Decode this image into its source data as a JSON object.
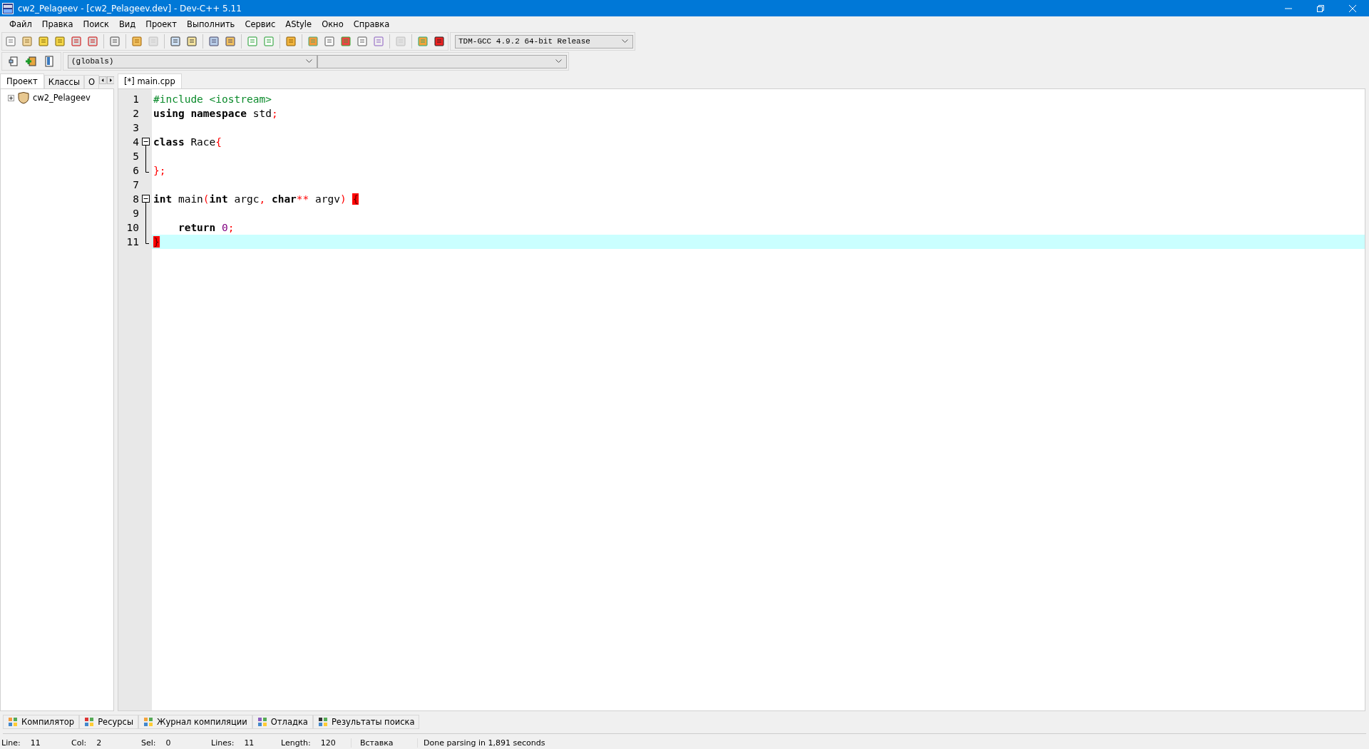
{
  "window": {
    "title": "cw2_Pelageev - [cw2_Pelageev.dev] - Dev-C++ 5.11"
  },
  "menu": [
    {
      "label": "Файл"
    },
    {
      "label": "Правка"
    },
    {
      "label": "Поиск"
    },
    {
      "label": "Вид"
    },
    {
      "label": "Проект"
    },
    {
      "label": "Выполнить"
    },
    {
      "label": "Сервис"
    },
    {
      "label": "AStyle"
    },
    {
      "label": "Окно"
    },
    {
      "label": "Справка"
    }
  ],
  "toolbar": [
    {
      "disabled": false
    },
    {
      "disabled": false
    },
    {
      "disabled": false
    },
    {
      "disabled": false
    },
    {
      "disabled": false
    },
    {
      "disabled": false
    },
    {
      "disabled": false
    },
    {
      "disabled": false
    },
    {
      "disabled": true
    },
    {
      "disabled": false
    },
    {
      "disabled": false
    },
    {
      "disabled": false
    },
    {
      "disabled": false
    },
    {
      "disabled": false
    },
    {
      "disabled": false
    },
    {
      "disabled": false
    },
    {
      "disabled": false
    },
    {
      "disabled": false
    },
    {
      "disabled": false
    },
    {
      "disabled": false
    },
    {
      "disabled": false
    },
    {
      "disabled": true
    },
    {
      "disabled": false
    },
    {
      "disabled": false
    }
  ],
  "compiler_select": {
    "value": "TDM-GCC 4.9.2 64-bit Release"
  },
  "scope_select": {
    "value": "(globals)"
  },
  "left_tabs": [
    {
      "label": "Проект",
      "selected": true
    },
    {
      "label": "Классы",
      "selected": false
    },
    {
      "label": "О",
      "selected": false
    }
  ],
  "project_tree": [
    {
      "label": "cw2_Pelageev",
      "expanded": false
    }
  ],
  "editor_tabs": [
    {
      "label": "[*] main.cpp",
      "selected": true
    }
  ],
  "code_lines": [
    {
      "number": "1",
      "kind": "plain",
      "current": false,
      "tokens": [
        {
          "kind": "preproc",
          "text": "#include <iostream>"
        }
      ]
    },
    {
      "number": "2",
      "kind": "plain",
      "current": false,
      "tokens": [
        {
          "kind": "keyword",
          "text": "using namespace"
        },
        {
          "kind": "plain",
          "text": " std"
        },
        {
          "kind": "punct",
          "text": ";"
        }
      ]
    },
    {
      "number": "3",
      "kind": "plain",
      "current": false
    },
    {
      "number": "4",
      "kind": "fold_start",
      "current": false,
      "tokens": [
        {
          "kind": "keyword",
          "text": "class"
        },
        {
          "kind": "plain",
          "text": " Race"
        },
        {
          "kind": "punct",
          "text": "{"
        }
      ]
    },
    {
      "number": "5",
      "kind": "fold_body",
      "current": false
    },
    {
      "number": "6",
      "kind": "fold_end",
      "current": false,
      "tokens": [
        {
          "kind": "punct",
          "text": "};"
        }
      ]
    },
    {
      "number": "7",
      "kind": "plain",
      "current": false
    },
    {
      "number": "8",
      "kind": "fold_start",
      "current": false,
      "tokens": [
        {
          "kind": "keyword",
          "text": "int"
        },
        {
          "kind": "plain",
          "text": " main"
        },
        {
          "kind": "punct",
          "text": "("
        },
        {
          "kind": "keyword",
          "text": "int"
        },
        {
          "kind": "plain",
          "text": " argc"
        },
        {
          "kind": "punct",
          "text": ","
        },
        {
          "kind": "keyword",
          "text": " char"
        },
        {
          "kind": "punct",
          "text": "**"
        },
        {
          "kind": "plain",
          "text": " argv"
        },
        {
          "kind": "punct",
          "text": ") "
        },
        {
          "kind": "brace_match",
          "text": "{"
        }
      ]
    },
    {
      "number": "9",
      "kind": "fold_body",
      "current": false
    },
    {
      "number": "10",
      "kind": "fold_body",
      "current": false,
      "tokens": [
        {
          "kind": "keyword",
          "text": "    return"
        },
        {
          "kind": "number",
          "text": " 0"
        },
        {
          "kind": "punct",
          "text": ";"
        }
      ]
    },
    {
      "number": "11",
      "kind": "fold_end",
      "current": true,
      "tokens": [
        {
          "kind": "brace_match",
          "text": "}"
        }
      ]
    }
  ],
  "bottom_tabs": [
    {
      "label": "Компилятор"
    },
    {
      "label": "Ресурсы"
    },
    {
      "label": "Журнал компиляции"
    },
    {
      "label": "Отладка"
    },
    {
      "label": "Результаты поиска"
    }
  ],
  "status_bar": [
    {
      "label": "Line:",
      "value": "11"
    },
    {
      "label": "Col:",
      "value": "2"
    },
    {
      "label": "Sel:",
      "value": "0"
    },
    {
      "label": "Lines:",
      "value": "11"
    },
    {
      "label": "Length:",
      "value": "120"
    }
  ],
  "status_mode": "Вставка",
  "status_message": "Done parsing in 1,891 seconds"
}
